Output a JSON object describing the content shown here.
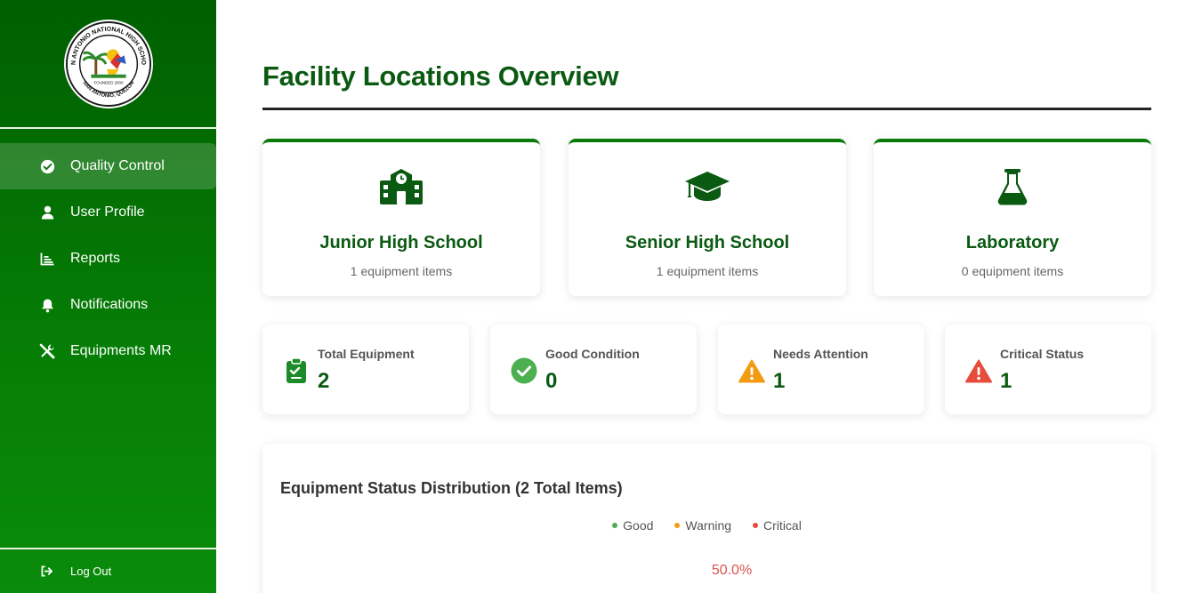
{
  "sidebar": {
    "logo": {
      "alt": "San Antonio National High School seal",
      "ring_top": "SAN ANTONIO NATIONAL HIGH SCHOOL",
      "ring_bottom": "SAN ANTONIO, QUEZON",
      "founded": "FOUNDED 2000"
    },
    "items": [
      {
        "label": "Quality Control",
        "icon": "check-circle-icon",
        "active": true
      },
      {
        "label": "User Profile",
        "icon": "user-icon",
        "active": false
      },
      {
        "label": "Reports",
        "icon": "chart-icon",
        "active": false
      },
      {
        "label": "Notifications",
        "icon": "bell-icon",
        "active": false
      },
      {
        "label": "Equipments MR",
        "icon": "tools-icon",
        "active": false
      }
    ],
    "logout_label": "Log Out"
  },
  "main": {
    "title": "Facility Locations Overview",
    "locations": [
      {
        "name": "Junior High School",
        "count": "1 equipment items",
        "icon": "school-icon"
      },
      {
        "name": "Senior High School",
        "count": "1 equipment items",
        "icon": "graduation-cap-icon"
      },
      {
        "name": "Laboratory",
        "count": "0 equipment items",
        "icon": "flask-icon"
      }
    ],
    "stats": [
      {
        "label": "Total Equipment",
        "value": "2",
        "icon": "clipboard-icon"
      },
      {
        "label": "Good Condition",
        "value": "0",
        "icon": "check-circle-icon"
      },
      {
        "label": "Needs Attention",
        "value": "1",
        "icon": "warning-icon"
      },
      {
        "label": "Critical Status",
        "value": "1",
        "icon": "critical-icon"
      }
    ],
    "chart": {
      "title": "Equipment Status Distribution (2 Total Items)",
      "legend": [
        {
          "label": "Good",
          "color": "#4caf50"
        },
        {
          "label": "Warning",
          "color": "#f39c12"
        },
        {
          "label": "Critical",
          "color": "#e74c3c"
        }
      ],
      "visible_label": "50.0%"
    }
  },
  "colors": {
    "brand_green": "#0b5a12",
    "sidebar_green": "#067e06",
    "good": "#4caf50",
    "warning": "#f39c12",
    "critical": "#e74c3c"
  },
  "chart_data": {
    "type": "pie",
    "title": "Equipment Status Distribution (2 Total Items)",
    "categories": [
      "Good",
      "Warning",
      "Critical"
    ],
    "values": [
      0,
      1,
      1
    ],
    "legend_position": "top-center"
  }
}
